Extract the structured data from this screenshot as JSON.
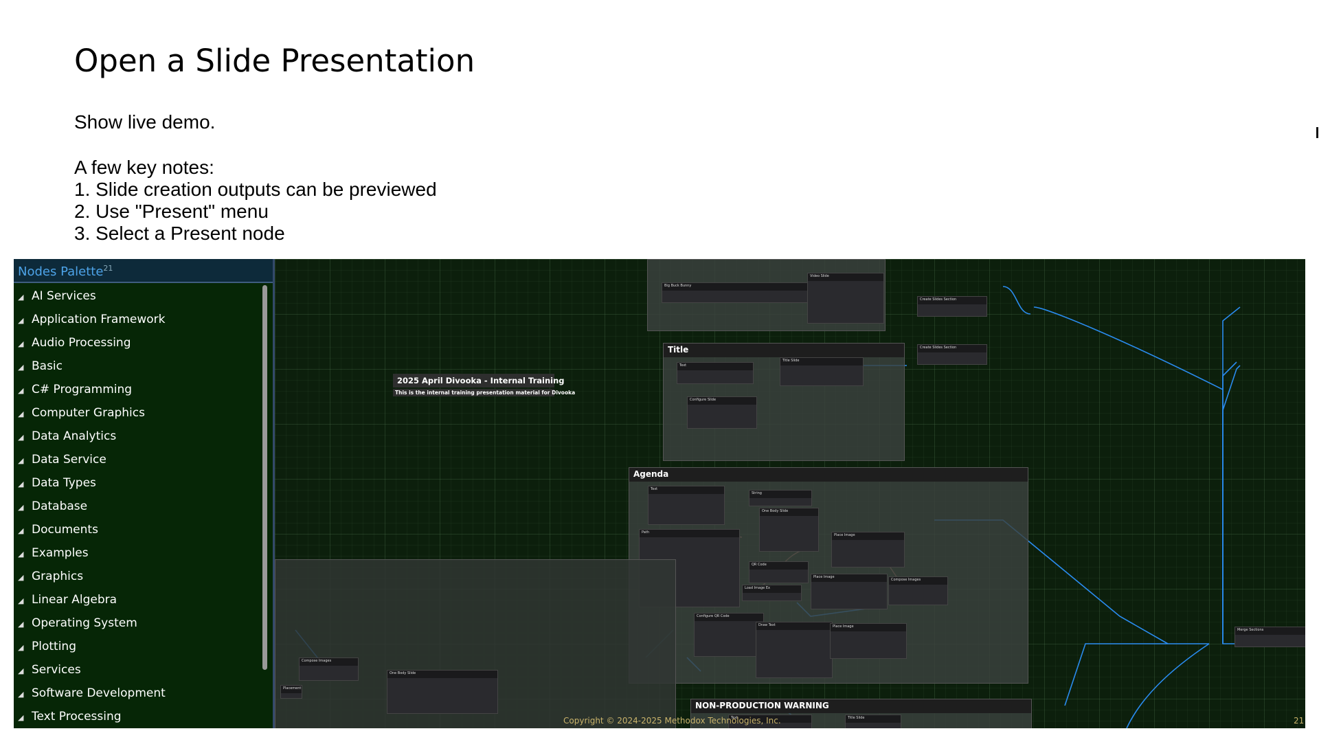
{
  "slide": {
    "title": "Open a Slide Presentation",
    "intro": "Show live demo.",
    "notes_heading": "A few key notes:",
    "notes": [
      "1. Slide creation outputs can be previewed",
      "2. Use \"Present\" menu",
      "3. Select a Present node"
    ]
  },
  "palette": {
    "title": "Nodes Palette",
    "count": "21",
    "expand_glyph": "◢",
    "categories": [
      "AI Services",
      "Application Framework",
      "Audio Processing",
      "Basic",
      "C# Programming",
      "Computer Graphics",
      "Data Analytics",
      "Data Service",
      "Data Types",
      "Database",
      "Documents",
      "Examples",
      "Graphics",
      "Linear Algebra",
      "Operating System",
      "Plotting",
      "Services",
      "Software Development",
      "Text Processing"
    ]
  },
  "canvas": {
    "note_title": "2025 April Divooka - Internal Training",
    "note_subtitle": "This is the internal training presentation material for Divooka",
    "groups": {
      "title": "Title",
      "agenda": "Agenda",
      "warning": "NON-PRODUCTION WARNING"
    },
    "nodes": {
      "video_slide": "Video Slide",
      "create_section_1": "Create Slides Section",
      "create_section_2": "Create Slides Section",
      "title_slide": "Title Slide",
      "configure_slide": "Configure Slide",
      "text": "Text",
      "string": "String",
      "one_body_slide": "One Body Slide",
      "path": "Path",
      "qr_code": "QR Code",
      "place_image_1": "Place Image",
      "place_image_2": "Place Image",
      "place_image_3": "Place Image",
      "compose_images": "Compose Images",
      "load_image": "Load Image Ex",
      "configure_qr": "Configure QR Code",
      "draw_text": "Draw Text",
      "merge_sections": "Merge Sections",
      "compose_images_left": "Compose Images",
      "one_body_slide_left": "One Body Slide",
      "title_slide_warn": "Title Slide"
    },
    "colors": {
      "wire": "#2a8cf0",
      "wire_alt": "#b07060",
      "grid": "#0c1f0c",
      "palette_bg": "#062606",
      "palette_title": "#4da3e8"
    }
  },
  "footer": {
    "copyright": "Copyright © 2024-2025 Methodox Technologies, Inc.",
    "page": "21"
  }
}
